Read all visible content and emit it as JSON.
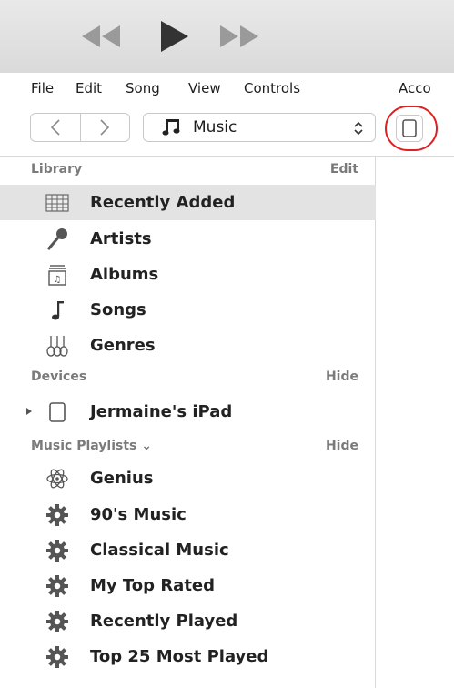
{
  "menubar": {
    "items": [
      "File",
      "Edit",
      "Song",
      "View",
      "Controls",
      "Acco"
    ]
  },
  "navbar": {
    "back_label": "<",
    "forward_label": ">",
    "media_label": "Music",
    "media_chevron": "⌃⌄"
  },
  "sidebar": {
    "library": {
      "title": "Library",
      "action": "Edit",
      "items": [
        "Recently Added",
        "Artists",
        "Albums",
        "Songs",
        "Genres"
      ]
    },
    "devices": {
      "title": "Devices",
      "action": "Hide",
      "items": [
        "Jermaine's iPad"
      ]
    },
    "playlists": {
      "title": "Music Playlists ⌄",
      "action": "Hide",
      "items": [
        "Genius",
        "90's Music",
        "Classical Music",
        "My Top Rated",
        "Recently Played",
        "Top 25 Most Played"
      ]
    }
  },
  "colors": {
    "selection": "#e3e3e3",
    "highlight_ring": "#e02020",
    "icon": "#4a4a4a"
  },
  "icons": {
    "transport": [
      "rewind-icon",
      "play-icon",
      "fast-forward-icon"
    ],
    "library": [
      "grid-icon",
      "microphone-icon",
      "album-icon",
      "note-icon",
      "guitar-icon"
    ],
    "devices": [
      "ipad-icon"
    ],
    "playlists": [
      "atom-icon",
      "gear-icon",
      "gear-icon",
      "gear-icon",
      "gear-icon",
      "gear-icon"
    ]
  }
}
